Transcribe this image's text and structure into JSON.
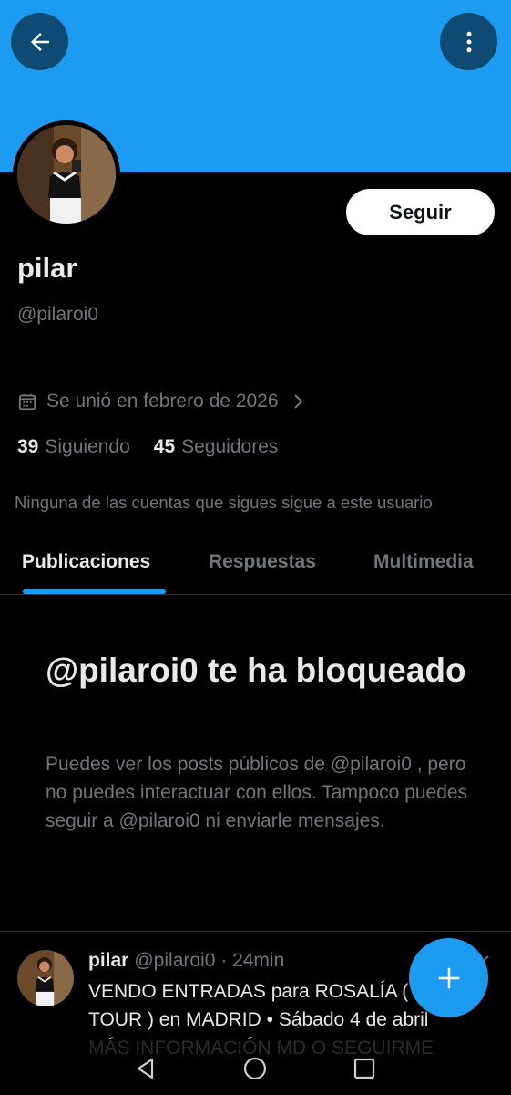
{
  "profile": {
    "name": "pilar",
    "handle": "@pilaroi0",
    "follow_label": "Seguir",
    "joined": "Se unió en febrero de 2026",
    "following_count": "39",
    "following_label": "Siguiendo",
    "followers_count": "45",
    "followers_label": "Seguidores",
    "no_mutual": "Ninguna de las cuentas que sigues sigue a este usuario"
  },
  "tabs": [
    {
      "label": "Publicaciones",
      "active": true
    },
    {
      "label": "Respuestas",
      "active": false
    },
    {
      "label": "Multimedia",
      "active": false
    }
  ],
  "blocked": {
    "title": "@pilaroi0 te ha bloqueado",
    "body": "Puedes ver los posts públicos de @pilaroi0 , pero no puedes interactuar con ellos. Tampoco puedes seguir a @pilaroi0 ni enviarle mensajes."
  },
  "post": {
    "name": "pilar",
    "handle": "@pilaroi0",
    "separator": "·",
    "time": "24min",
    "text": "VENDO ENTRADAS para ROSALÍA ( LUX TOUR ) en MADRID • Sábado 4 de abril MÁS INFORMACIÓN MD O SEGUIRME"
  },
  "colors": {
    "accent": "#1d9bf0",
    "background": "#000000",
    "secondary_text": "#71767b"
  },
  "icons": {
    "back": "arrow-left-icon",
    "more": "vertical-dots-icon",
    "calendar": "calendar-icon",
    "chevron": "chevron-right-icon",
    "fab": "plus-icon",
    "nav_back": "triangle-back-icon",
    "nav_home": "circle-home-icon",
    "nav_recents": "square-recents-icon"
  }
}
